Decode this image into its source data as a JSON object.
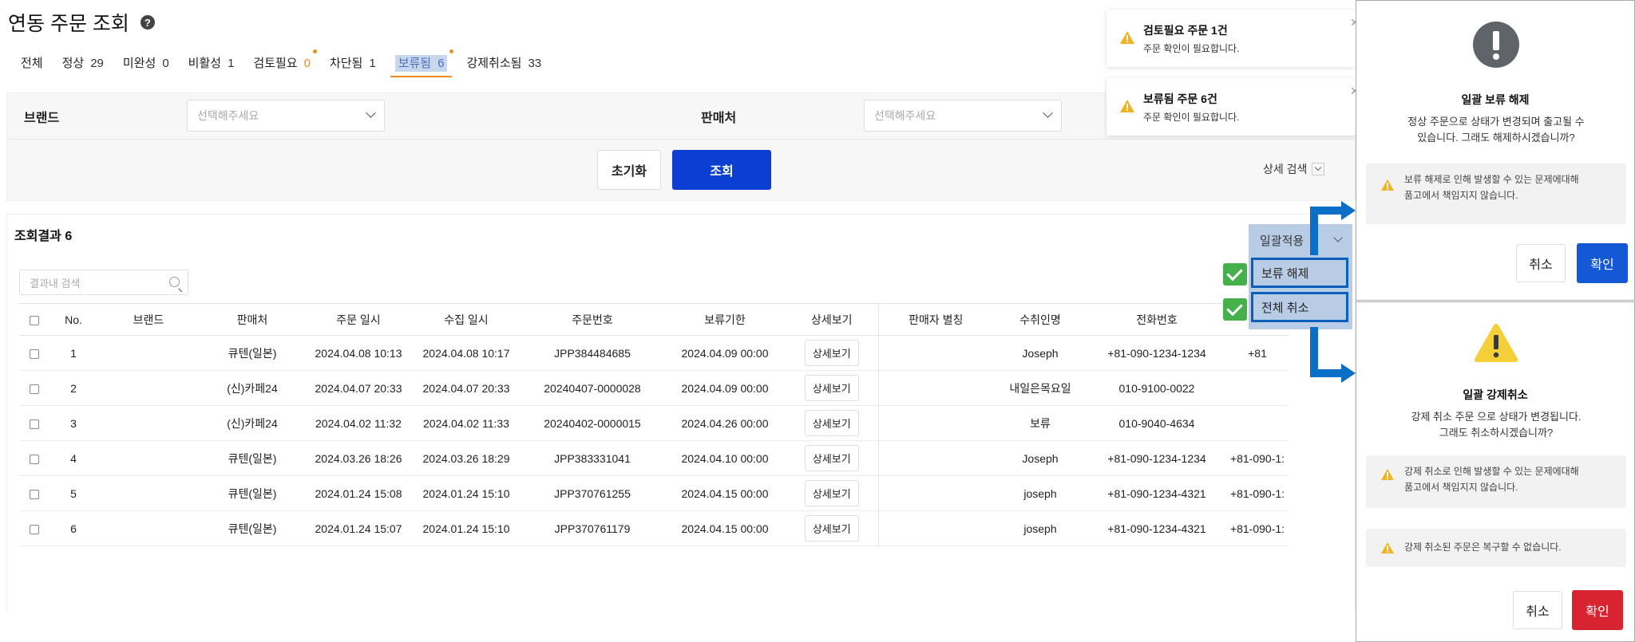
{
  "page": {
    "title": "연동 주문 조회"
  },
  "tabs": [
    {
      "label": "전체",
      "count": ""
    },
    {
      "label": "정상",
      "count": "29"
    },
    {
      "label": "미완성",
      "count": "0"
    },
    {
      "label": "비활성",
      "count": "1"
    },
    {
      "label": "검토필요",
      "count": "0"
    },
    {
      "label": "차단됨",
      "count": "1"
    },
    {
      "label": "보류됨",
      "count": "6"
    },
    {
      "label": "강제취소됨",
      "count": "33"
    }
  ],
  "filters": {
    "brand_label": "브랜드",
    "brand_placeholder": "선택해주세요",
    "seller_label": "판매처",
    "seller_placeholder": "선택해주세요",
    "reset_label": "초기화",
    "search_label": "조회",
    "detail_search_label": "상세 검색"
  },
  "results": {
    "title": "조회결과 6",
    "inner_search_placeholder": "결과내 검색",
    "bulk_label": "일괄적용",
    "bulk_menu": [
      "보류 해제",
      "전체 취소"
    ]
  },
  "table": {
    "headers": [
      "No.",
      "브랜드",
      "판매처",
      "주문 일시",
      "수집 일시",
      "주문번호",
      "보류기한",
      "상세보기",
      "판매자 별칭",
      "수취인명",
      "전화번호",
      ""
    ],
    "detail_button_label": "상세보기",
    "rows": [
      [
        "1",
        "",
        "큐텐(일본)",
        "2024.04.08 10:13",
        "2024.04.08 10:17",
        "JPP384484685",
        "2024.04.09 00:00",
        "",
        "Joseph",
        "+81-090-1234-1234",
        "+81"
      ],
      [
        "2",
        "",
        "(신)카페24",
        "2024.04.07 20:33",
        "2024.04.07 20:33",
        "20240407-0000028",
        "2024.04.09 00:00",
        "",
        "내일은목요일",
        "010-9100-0022",
        ""
      ],
      [
        "3",
        "",
        "(신)카페24",
        "2024.04.02 11:32",
        "2024.04.02 11:33",
        "20240402-0000015",
        "2024.04.26 00:00",
        "",
        "보류",
        "010-9040-4634",
        ""
      ],
      [
        "4",
        "",
        "큐텐(일본)",
        "2024.03.26 18:26",
        "2024.03.26 18:29",
        "JPP383331041",
        "2024.04.10 00:00",
        "",
        "Joseph",
        "+81-090-1234-1234",
        "+81-090-1:"
      ],
      [
        "5",
        "",
        "큐텐(일본)",
        "2024.01.24 15:08",
        "2024.01.24 15:10",
        "JPP370761255",
        "2024.04.15 00:00",
        "",
        "joseph",
        "+81-090-1234-4321",
        "+81-090-1:"
      ],
      [
        "6",
        "",
        "큐텐(일본)",
        "2024.01.24 15:07",
        "2024.01.24 15:10",
        "JPP370761179",
        "2024.04.15 00:00",
        "",
        "joseph",
        "+81-090-1234-4321",
        "+81-090-1:"
      ]
    ]
  },
  "toasts": [
    {
      "title": "검토필요 주문 1건",
      "body": "주문 확인이 필요합니다."
    },
    {
      "title": "보류됨 주문 6건",
      "body": "주문 확인이 필요합니다."
    }
  ],
  "modal_release": {
    "title": "일괄 보류 해제",
    "body_line1": "정상 주문으로 상태가 변경되며 출고될 수",
    "body_line2": "있습니다. 그래도 해제하시겠습니까?",
    "notice_line1": "보류 해제로 인해 발생할 수 있는 문제에대해",
    "notice_line2": "품고에서 책임지지 않습니다.",
    "cancel_label": "취소",
    "confirm_label": "확인",
    "confirm_color": "#1558d6"
  },
  "modal_cancel": {
    "title": "일괄 강제취소",
    "body_line1": "강제 취소 주문 으로 상태가 변경됩니다.",
    "body_line2": "그래도 취소하시겠습니까?",
    "notice1_line1": "강제 취소로 인해 발생할 수 있는 문제에대해",
    "notice1_line2": "품고에서 책임지지 않습니다.",
    "notice2": "강제 취소된 주문은 복구할 수 없습니다.",
    "cancel_label": "취소",
    "confirm_label": "확인",
    "confirm_color": "#d82331"
  },
  "colors": {
    "primary": "#0b3fd1",
    "accent_orange": "#f08c1a",
    "annotation_blue": "#0b6fc8",
    "check_green": "#46b04a"
  }
}
